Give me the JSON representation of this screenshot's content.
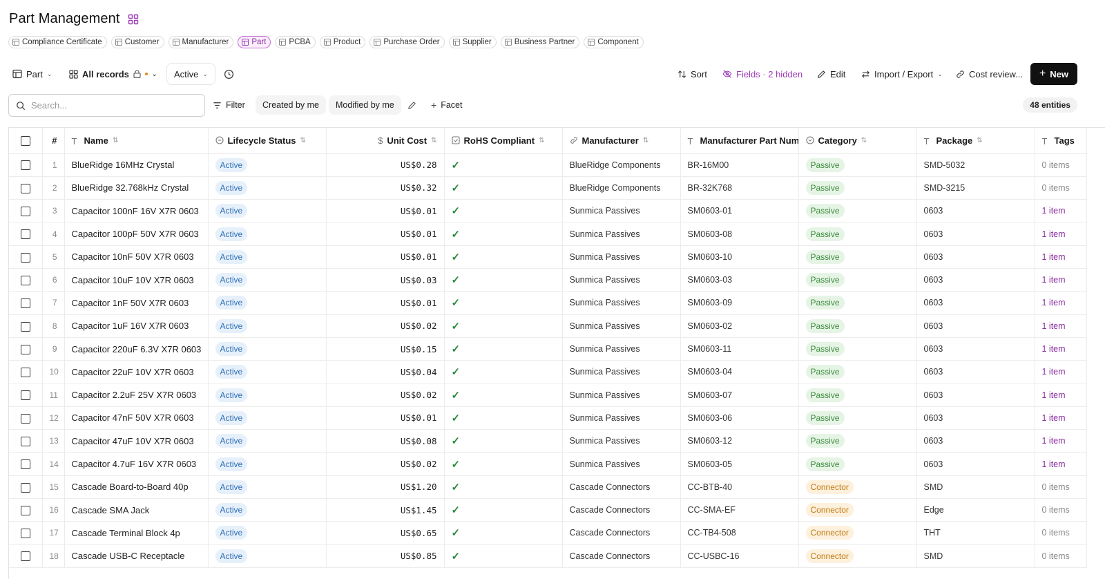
{
  "page": {
    "title": "Part Management"
  },
  "entity_tabs": [
    {
      "label": "Compliance Certificate",
      "active": false
    },
    {
      "label": "Customer",
      "active": false
    },
    {
      "label": "Manufacturer",
      "active": false
    },
    {
      "label": "Part",
      "active": true
    },
    {
      "label": "PCBA",
      "active": false
    },
    {
      "label": "Product",
      "active": false
    },
    {
      "label": "Purchase Order",
      "active": false
    },
    {
      "label": "Supplier",
      "active": false
    },
    {
      "label": "Business Partner",
      "active": false
    },
    {
      "label": "Component",
      "active": false
    }
  ],
  "toolbar": {
    "entity_selector": "Part",
    "view_selector": "All records",
    "status_filter": "Active",
    "sort": "Sort",
    "fields": "Fields · 2 hidden",
    "edit": "Edit",
    "import_export": "Import / Export",
    "cost_review": "Cost review...",
    "new": "New"
  },
  "filterbar": {
    "search_placeholder": "Search...",
    "filter": "Filter",
    "created_by_me": "Created by me",
    "modified_by_me": "Modified by me",
    "facet": "Facet",
    "entity_count": "48 entities"
  },
  "columns": {
    "num": "#",
    "name": "Name",
    "lifecycle": "Lifecycle Status",
    "unit_cost": "Unit Cost",
    "rohs": "RoHS Compliant",
    "manufacturer": "Manufacturer",
    "mpn": "Manufacturer Part Number",
    "category": "Category",
    "package": "Package",
    "tags": "Tags"
  },
  "rows": [
    {
      "num": "1",
      "name": "BlueRidge 16MHz Crystal",
      "status": "Active",
      "cost": "US$0.28",
      "rohs": true,
      "mfr": "BlueRidge Components",
      "mpn": "BR-16M00",
      "category": "Passive",
      "package": "SMD-5032",
      "tags": "0 items"
    },
    {
      "num": "2",
      "name": "BlueRidge 32.768kHz Crystal",
      "status": "Active",
      "cost": "US$0.32",
      "rohs": true,
      "mfr": "BlueRidge Components",
      "mpn": "BR-32K768",
      "category": "Passive",
      "package": "SMD-3215",
      "tags": "0 items"
    },
    {
      "num": "3",
      "name": "Capacitor 100nF 16V X7R 0603",
      "status": "Active",
      "cost": "US$0.01",
      "rohs": true,
      "mfr": "Sunmica Passives",
      "mpn": "SM0603-01",
      "category": "Passive",
      "package": "0603",
      "tags": "1 item"
    },
    {
      "num": "4",
      "name": "Capacitor 100pF 50V X7R 0603",
      "status": "Active",
      "cost": "US$0.01",
      "rohs": true,
      "mfr": "Sunmica Passives",
      "mpn": "SM0603-08",
      "category": "Passive",
      "package": "0603",
      "tags": "1 item"
    },
    {
      "num": "5",
      "name": "Capacitor 10nF 50V X7R 0603",
      "status": "Active",
      "cost": "US$0.01",
      "rohs": true,
      "mfr": "Sunmica Passives",
      "mpn": "SM0603-10",
      "category": "Passive",
      "package": "0603",
      "tags": "1 item"
    },
    {
      "num": "6",
      "name": "Capacitor 10uF 10V X7R 0603",
      "status": "Active",
      "cost": "US$0.03",
      "rohs": true,
      "mfr": "Sunmica Passives",
      "mpn": "SM0603-03",
      "category": "Passive",
      "package": "0603",
      "tags": "1 item"
    },
    {
      "num": "7",
      "name": "Capacitor 1nF 50V X7R 0603",
      "status": "Active",
      "cost": "US$0.01",
      "rohs": true,
      "mfr": "Sunmica Passives",
      "mpn": "SM0603-09",
      "category": "Passive",
      "package": "0603",
      "tags": "1 item"
    },
    {
      "num": "8",
      "name": "Capacitor 1uF 16V X7R 0603",
      "status": "Active",
      "cost": "US$0.02",
      "rohs": true,
      "mfr": "Sunmica Passives",
      "mpn": "SM0603-02",
      "category": "Passive",
      "package": "0603",
      "tags": "1 item"
    },
    {
      "num": "9",
      "name": "Capacitor 220uF 6.3V X7R 0603",
      "status": "Active",
      "cost": "US$0.15",
      "rohs": true,
      "mfr": "Sunmica Passives",
      "mpn": "SM0603-11",
      "category": "Passive",
      "package": "0603",
      "tags": "1 item"
    },
    {
      "num": "10",
      "name": "Capacitor 22uF 10V X7R 0603",
      "status": "Active",
      "cost": "US$0.04",
      "rohs": true,
      "mfr": "Sunmica Passives",
      "mpn": "SM0603-04",
      "category": "Passive",
      "package": "0603",
      "tags": "1 item"
    },
    {
      "num": "11",
      "name": "Capacitor 2.2uF 25V X7R 0603",
      "status": "Active",
      "cost": "US$0.02",
      "rohs": true,
      "mfr": "Sunmica Passives",
      "mpn": "SM0603-07",
      "category": "Passive",
      "package": "0603",
      "tags": "1 item"
    },
    {
      "num": "12",
      "name": "Capacitor 47nF 50V X7R 0603",
      "status": "Active",
      "cost": "US$0.01",
      "rohs": true,
      "mfr": "Sunmica Passives",
      "mpn": "SM0603-06",
      "category": "Passive",
      "package": "0603",
      "tags": "1 item"
    },
    {
      "num": "13",
      "name": "Capacitor 47uF 10V X7R 0603",
      "status": "Active",
      "cost": "US$0.08",
      "rohs": true,
      "mfr": "Sunmica Passives",
      "mpn": "SM0603-12",
      "category": "Passive",
      "package": "0603",
      "tags": "1 item"
    },
    {
      "num": "14",
      "name": "Capacitor 4.7uF 16V X7R 0603",
      "status": "Active",
      "cost": "US$0.02",
      "rohs": true,
      "mfr": "Sunmica Passives",
      "mpn": "SM0603-05",
      "category": "Passive",
      "package": "0603",
      "tags": "1 item"
    },
    {
      "num": "15",
      "name": "Cascade Board-to-Board 40p",
      "status": "Active",
      "cost": "US$1.20",
      "rohs": true,
      "mfr": "Cascade Connectors",
      "mpn": "CC-BTB-40",
      "category": "Connector",
      "package": "SMD",
      "tags": "0 items"
    },
    {
      "num": "16",
      "name": "Cascade SMA Jack",
      "status": "Active",
      "cost": "US$1.45",
      "rohs": true,
      "mfr": "Cascade Connectors",
      "mpn": "CC-SMA-EF",
      "category": "Connector",
      "package": "Edge",
      "tags": "0 items"
    },
    {
      "num": "17",
      "name": "Cascade Terminal Block 4p",
      "status": "Active",
      "cost": "US$0.65",
      "rohs": true,
      "mfr": "Cascade Connectors",
      "mpn": "CC-TB4-508",
      "category": "Connector",
      "package": "THT",
      "tags": "0 items"
    },
    {
      "num": "18",
      "name": "Cascade USB-C Receptacle",
      "status": "Active",
      "cost": "US$0.85",
      "rohs": true,
      "mfr": "Cascade Connectors",
      "mpn": "CC-USBC-16",
      "category": "Connector",
      "package": "SMD",
      "tags": "0 items"
    }
  ]
}
